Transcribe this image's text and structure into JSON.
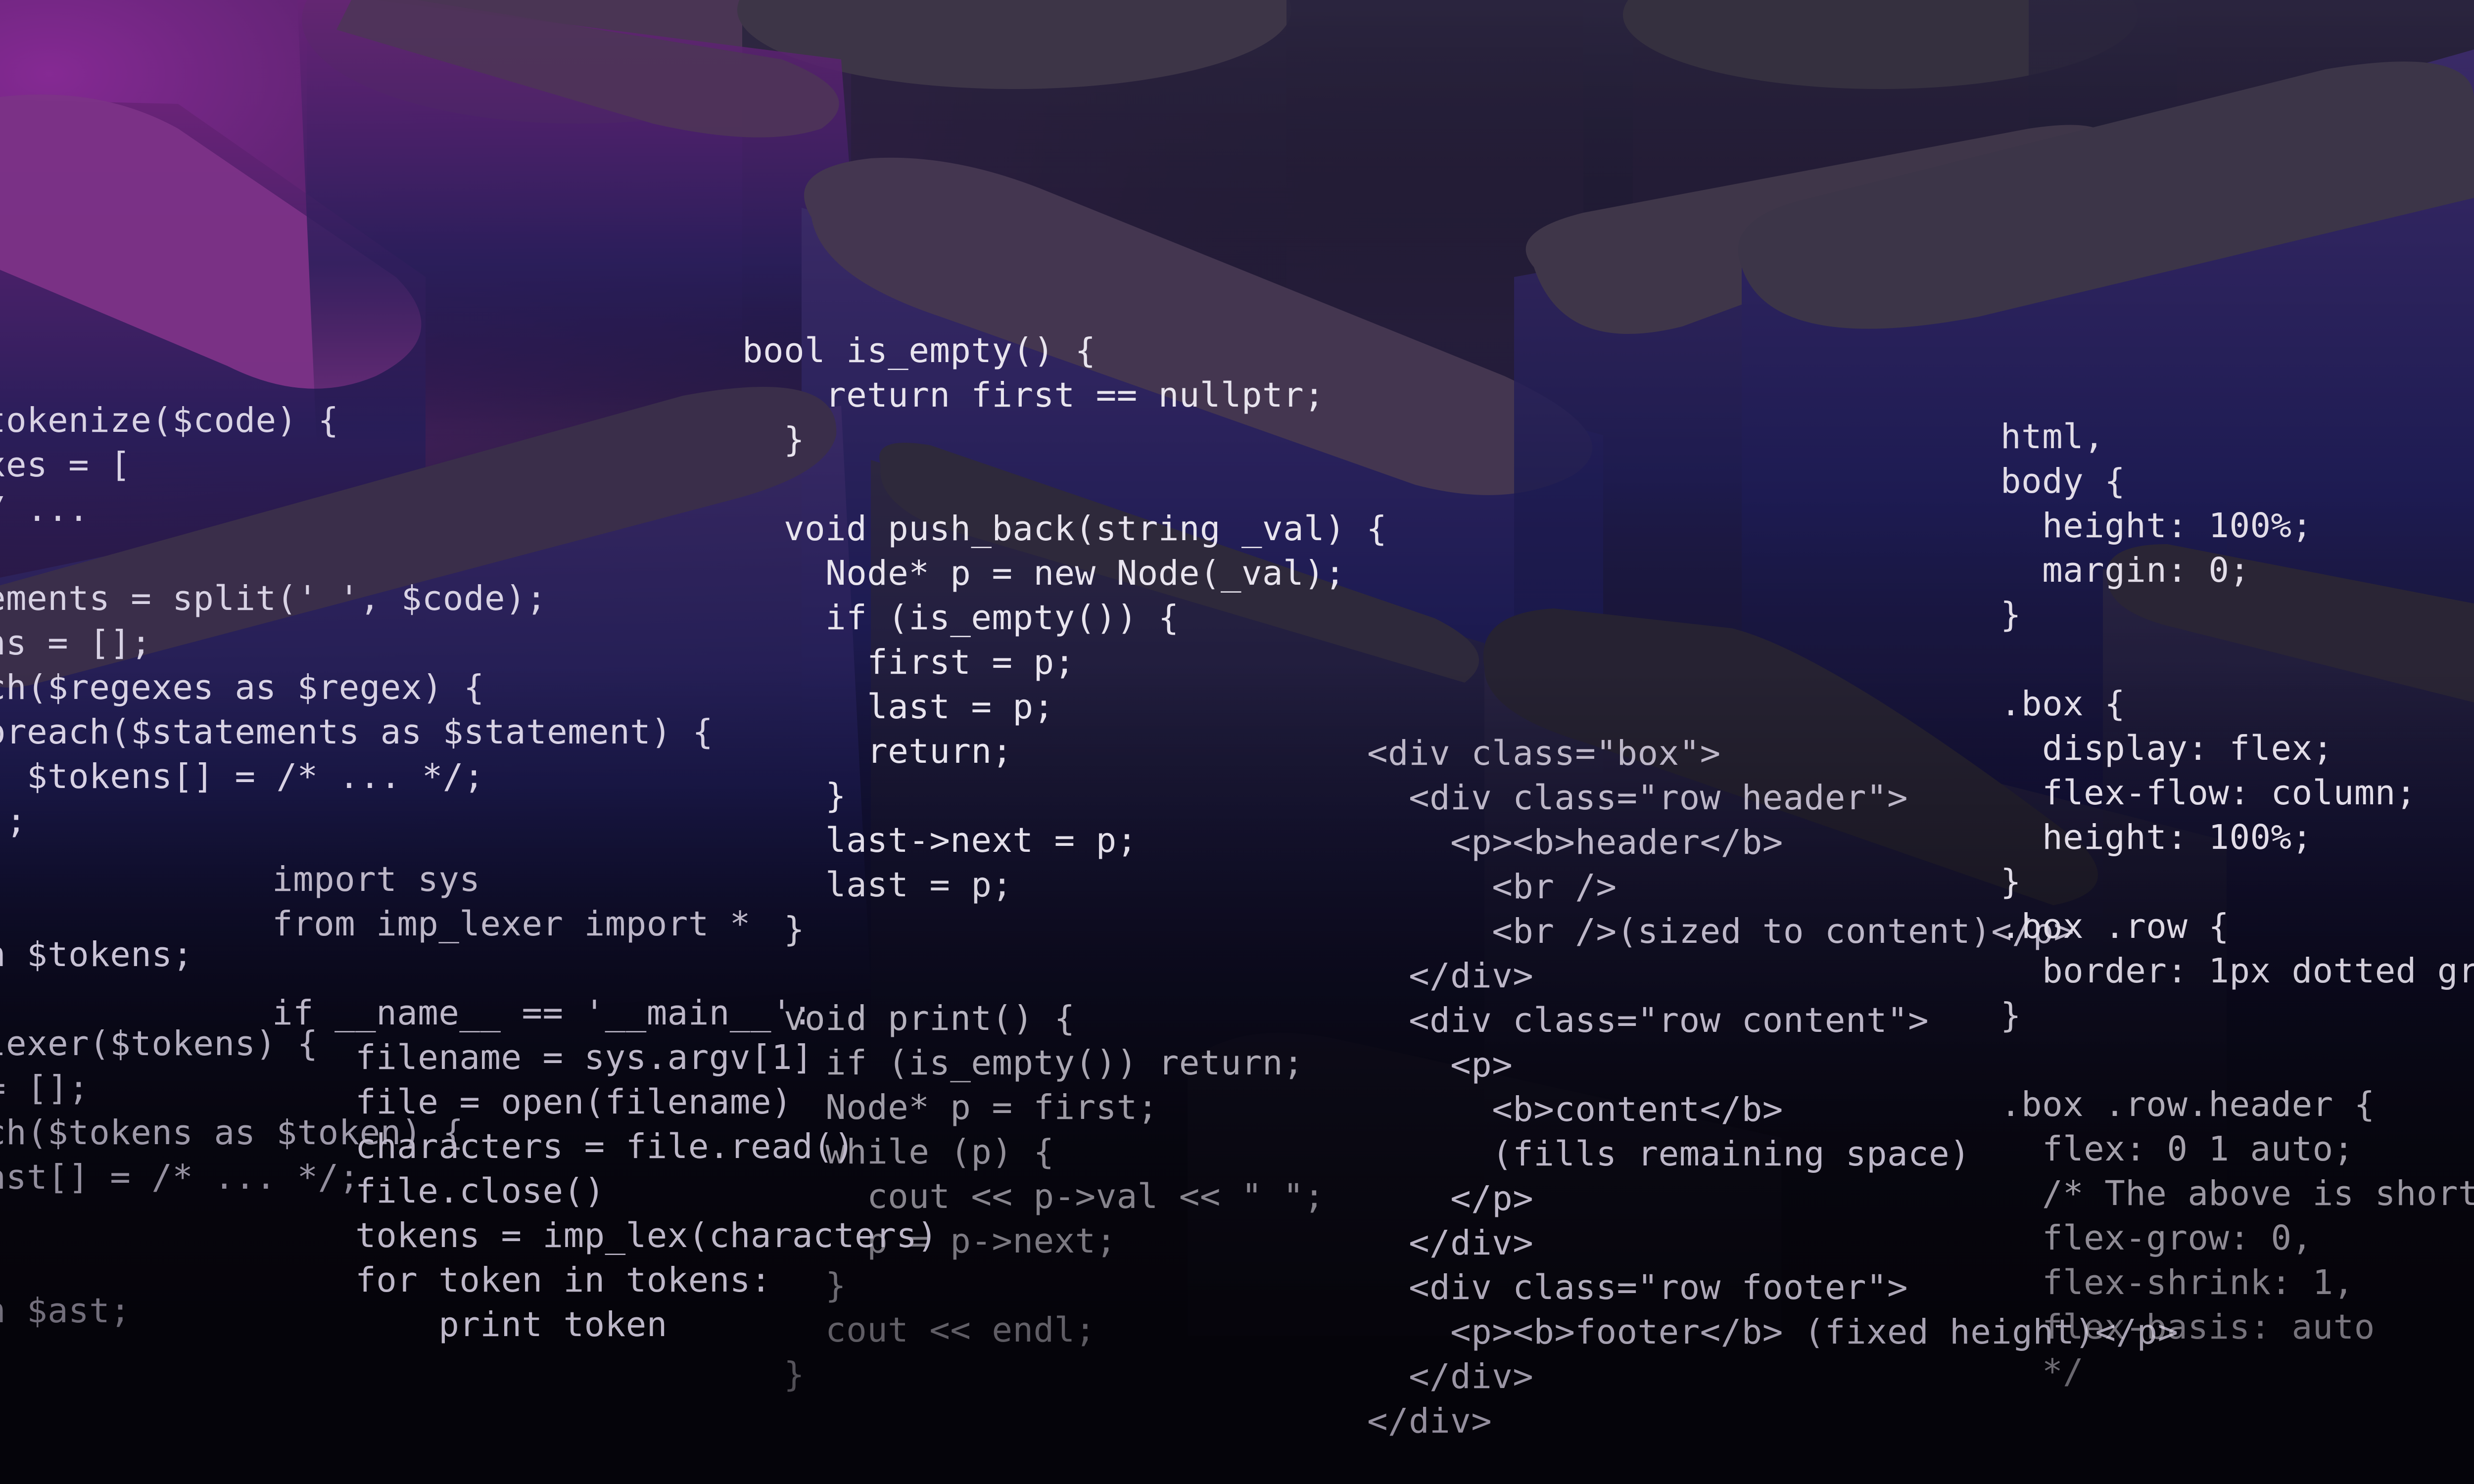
{
  "background": {
    "description_colors": {
      "deep": "#07060c",
      "navy": "#1b1a48",
      "purple": "#8a2a98",
      "shape_top": "#4a3d5c"
    }
  },
  "code_blocks": {
    "php": "tokenize($code) {\nxes = [\n/ ...\n\nements = split(' ', $code);\nns = [];\nch($regexes as $regex) {\noreach($statements as $statement) {\n  $tokens[] = /* ... */;\n);\n\n\nn $tokens;\n\nlexer($tokens) {\n= [];\nch($tokens as $token) {\nast[] = /* ... */;\n\n\nn $ast;",
    "cpp": "bool is_empty() {\n    return first == nullptr;\n  }\n\n  void push_back(string _val) {\n    Node* p = new Node(_val);\n    if (is_empty()) {\n      first = p;\n      last = p;\n      return;\n    }\n    last->next = p;\n    last = p;\n  }\n\n  void print() {\n    if (is_empty()) return;\n    Node* p = first;\n    while (p) {\n      cout << p->val << \" \";\n      p = p->next;\n    }\n    cout << endl;\n  }",
    "python": "import sys\nfrom imp_lexer import *\n\nif __name__ == '__main__':\n    filename = sys.argv[1]\n    file = open(filename)\n    characters = file.read()\n    file.close()\n    tokens = imp_lex(characters)\n    for token in tokens:\n        print token",
    "html": "<div class=\"box\">\n  <div class=\"row header\">\n    <p><b>header</b>\n      <br />\n      <br />(sized to content)</p>\n  </div>\n  <div class=\"row content\">\n    <p>\n      <b>content</b>\n      (fills remaining space)\n    </p>\n  </div>\n  <div class=\"row footer\">\n    <p><b>footer</b> (fixed height)</p>\n  </div>\n</div>",
    "css": "html,\nbody {\n  height: 100%;\n  margin: 0;\n}\n\n.box {\n  display: flex;\n  flex-flow: column;\n  height: 100%;\n}\n.box .row {\n  border: 1px dotted gr\n}\n\n.box .row.header {\n  flex: 0 1 auto;\n  /* The above is short\n  flex-grow: 0,\n  flex-shrink: 1,\n  flex-basis: auto\n  */"
  }
}
